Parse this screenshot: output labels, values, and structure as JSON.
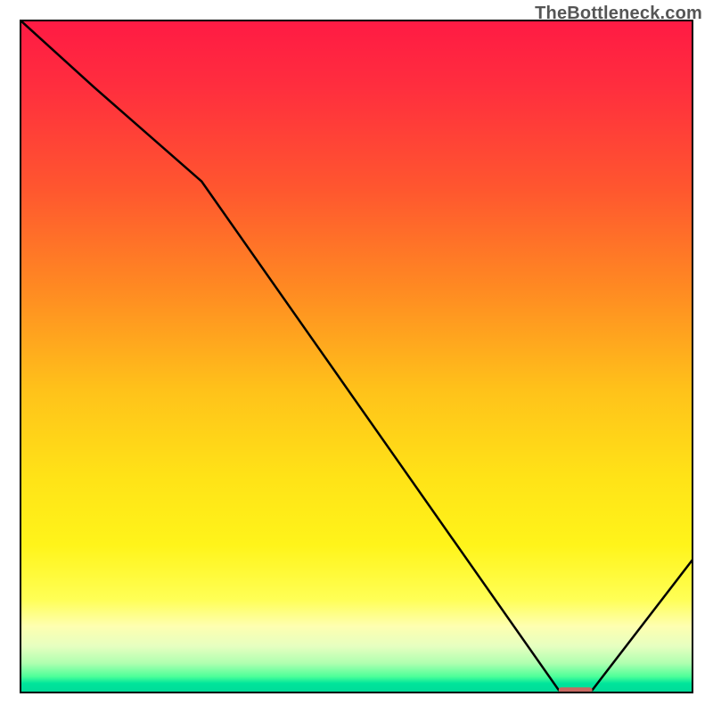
{
  "watermark": "TheBottleneck.com",
  "colors": {
    "border": "#000000",
    "watermark": "#555555",
    "line": "#000000",
    "marker_fill": "#c96861",
    "gradient_stops": [
      {
        "offset": 0.0,
        "color": "#ff1a44"
      },
      {
        "offset": 0.1,
        "color": "#ff2e3e"
      },
      {
        "offset": 0.25,
        "color": "#ff562f"
      },
      {
        "offset": 0.4,
        "color": "#ff8a22"
      },
      {
        "offset": 0.55,
        "color": "#ffc21a"
      },
      {
        "offset": 0.68,
        "color": "#ffe317"
      },
      {
        "offset": 0.78,
        "color": "#fff41a"
      },
      {
        "offset": 0.86,
        "color": "#ffff55"
      },
      {
        "offset": 0.9,
        "color": "#feffb0"
      },
      {
        "offset": 0.93,
        "color": "#e6ffc0"
      },
      {
        "offset": 0.955,
        "color": "#b0ffb0"
      },
      {
        "offset": 0.975,
        "color": "#4dff99"
      },
      {
        "offset": 0.985,
        "color": "#00e59b"
      },
      {
        "offset": 1.0,
        "color": "#00d998"
      }
    ]
  },
  "chart_data": {
    "type": "line",
    "title": "",
    "xlabel": "",
    "ylabel": "",
    "xlim": [
      0,
      100
    ],
    "ylim": [
      0,
      100
    ],
    "series": [
      {
        "name": "bottleneck-curve",
        "x": [
          0,
          11,
          27,
          80,
          85,
          100
        ],
        "y": [
          100,
          90,
          76,
          0.5,
          0.5,
          20
        ]
      }
    ],
    "marker": {
      "name": "optimal-range-marker",
      "x0": 80,
      "x1": 85,
      "y": 0.5
    },
    "annotations": []
  }
}
